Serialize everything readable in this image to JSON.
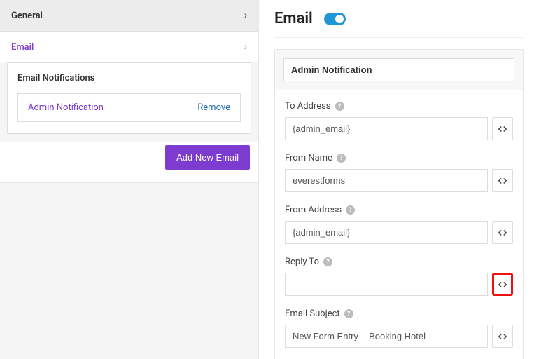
{
  "sidebar": {
    "general_label": "General",
    "email_label": "Email"
  },
  "notifications": {
    "heading": "Email Notifications",
    "items": [
      {
        "name": "Admin Notification",
        "remove_label": "Remove"
      }
    ],
    "add_button": "Add New Email"
  },
  "email_settings": {
    "page_title": "Email",
    "toggle_on": true,
    "notification_name": "Admin Notification",
    "fields": {
      "to_address": {
        "label": "To Address",
        "value": "{admin_email}"
      },
      "from_name": {
        "label": "From Name",
        "value": "everestforms"
      },
      "from_address": {
        "label": "From Address",
        "value": "{admin_email}"
      },
      "reply_to": {
        "label": "Reply To",
        "value": ""
      },
      "email_subject": {
        "label": "Email Subject",
        "value": "New Form Entry  - Booking Hotel"
      }
    }
  }
}
